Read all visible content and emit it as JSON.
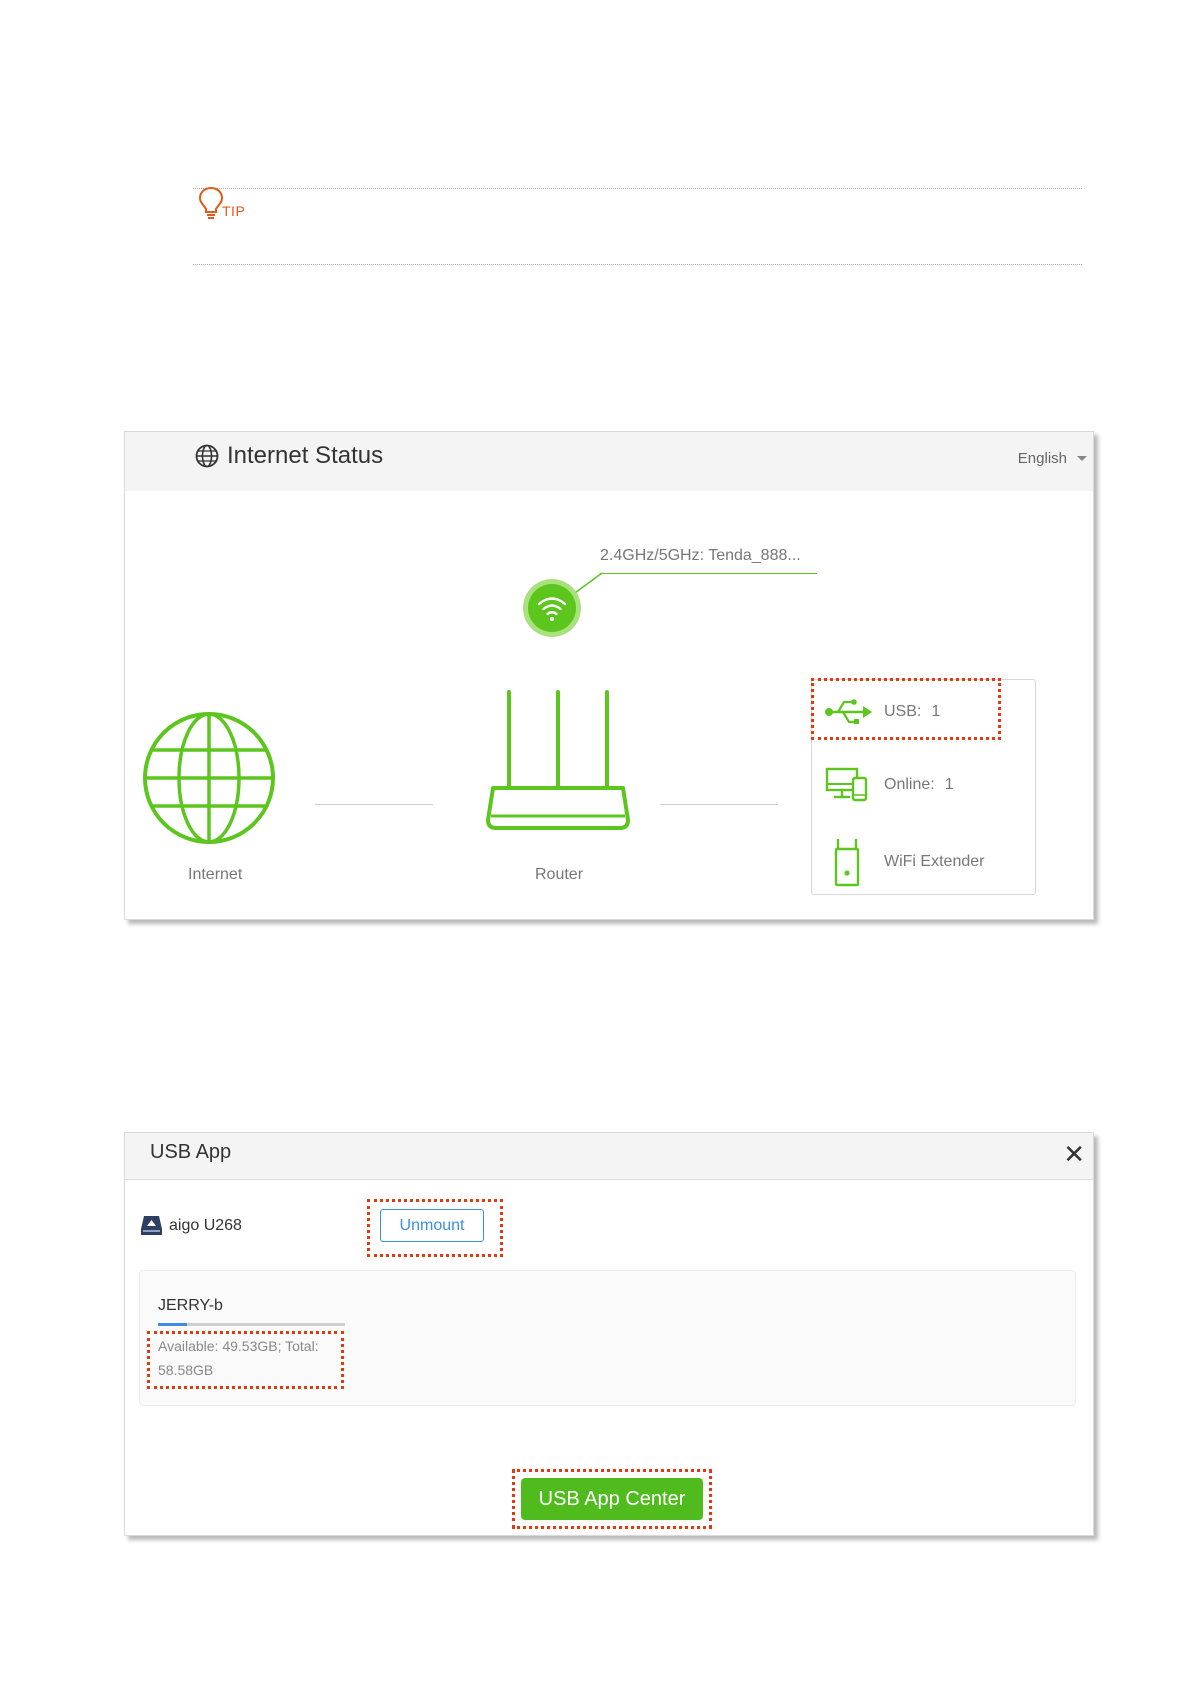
{
  "tip": {
    "label": "TIP"
  },
  "internet_status": {
    "title": "Internet Status",
    "language": "English",
    "ssid": "2.4GHz/5GHz: Tenda_888...",
    "internet_label": "Internet",
    "router_label": "Router",
    "devices": {
      "usb_label": "USB:",
      "usb_count": "1",
      "online_label": "Online:",
      "online_count": "1",
      "extender_label": "WiFi Extender"
    }
  },
  "usb_app": {
    "title": "USB App",
    "close_glyph": "✕",
    "drive_name": "aigo U268",
    "unmount_label": "Unmount",
    "partition": {
      "name": "JERRY-b",
      "usage_used_fraction": 0.155,
      "info_line1": "Available: 49.53GB; Total:",
      "info_line2": "58.58GB"
    },
    "center_button_label": "USB App Center"
  },
  "colors": {
    "accent_green": "#5cc61f",
    "highlight": "#e23a0f",
    "link_blue": "#3a8ee6",
    "tip_orange": "#e35a1a"
  },
  "icons": [
    "lightbulb-icon",
    "globe-icon",
    "wifi-icon",
    "router-icon",
    "usb-icon",
    "devices-icon",
    "extender-icon",
    "usb-drive-icon",
    "close-icon"
  ]
}
